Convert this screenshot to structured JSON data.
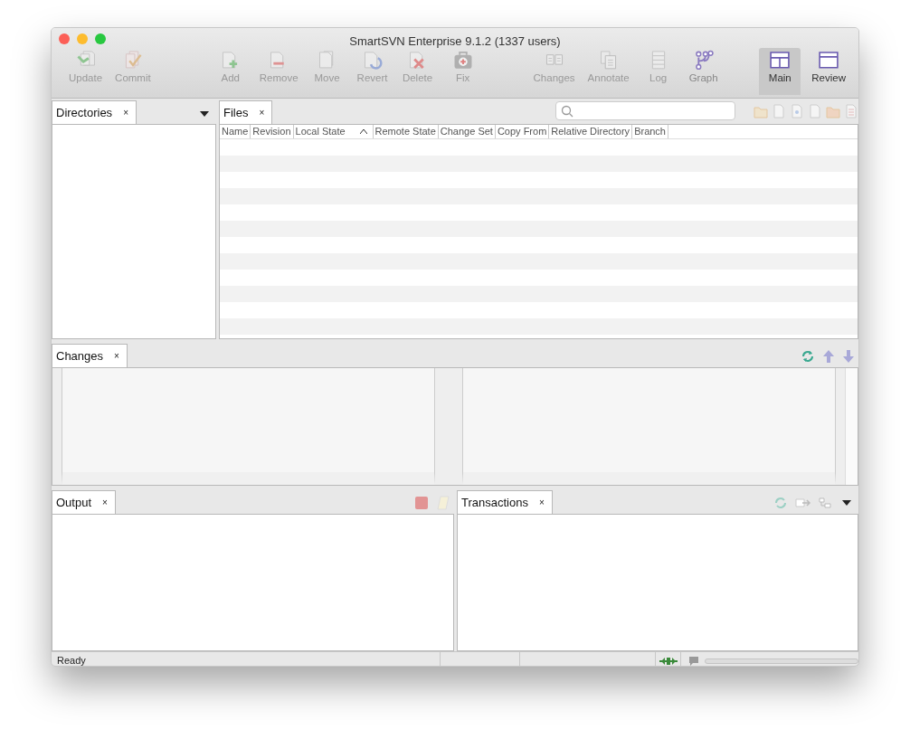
{
  "window": {
    "title": "SmartSVN Enterprise 9.1.2 (1337 users)"
  },
  "toolbar": {
    "groups": [
      [
        {
          "label": "Update",
          "disabled": true
        },
        {
          "label": "Commit",
          "disabled": true
        }
      ],
      [
        {
          "label": "Add",
          "disabled": true
        },
        {
          "label": "Remove",
          "disabled": true
        },
        {
          "label": "Move",
          "disabled": true
        },
        {
          "label": "Revert",
          "disabled": true
        },
        {
          "label": "Delete",
          "disabled": true
        },
        {
          "label": "Fix",
          "disabled": true
        }
      ],
      [
        {
          "label": "Changes",
          "disabled": true
        },
        {
          "label": "Annotate",
          "disabled": true
        },
        {
          "label": "Log",
          "disabled": true
        },
        {
          "label": "Graph",
          "disabled": false
        }
      ]
    ],
    "views": [
      {
        "label": "Main",
        "selected": true
      },
      {
        "label": "Review",
        "selected": false
      }
    ]
  },
  "directories": {
    "tabs": [
      {
        "label": "Directories",
        "close": "×",
        "selected": true
      }
    ]
  },
  "files": {
    "tabs": [
      {
        "label": "Files",
        "close": "×",
        "selected": true
      }
    ],
    "columns": [
      {
        "label": "Name",
        "sorted": false
      },
      {
        "label": "Revision",
        "sorted": false
      },
      {
        "label": "Local State",
        "sorted": true
      },
      {
        "label": "Remote State",
        "sorted": false
      },
      {
        "label": "Change Set",
        "sorted": false
      },
      {
        "label": "Copy From",
        "sorted": false
      },
      {
        "label": "Relative Directory",
        "sorted": false
      },
      {
        "label": "Branch",
        "sorted": false
      }
    ]
  },
  "changes": {
    "tabs": [
      {
        "label": "Changes",
        "close": "×",
        "selected": true
      }
    ]
  },
  "output": {
    "tabs": [
      {
        "label": "Output",
        "close": "×",
        "selected": true
      }
    ]
  },
  "transactions": {
    "tabs": [
      {
        "label": "Transactions",
        "close": "×",
        "selected": true
      }
    ]
  },
  "status_bar": {
    "text": "Ready",
    "progress": {
      "level": 0
    }
  }
}
